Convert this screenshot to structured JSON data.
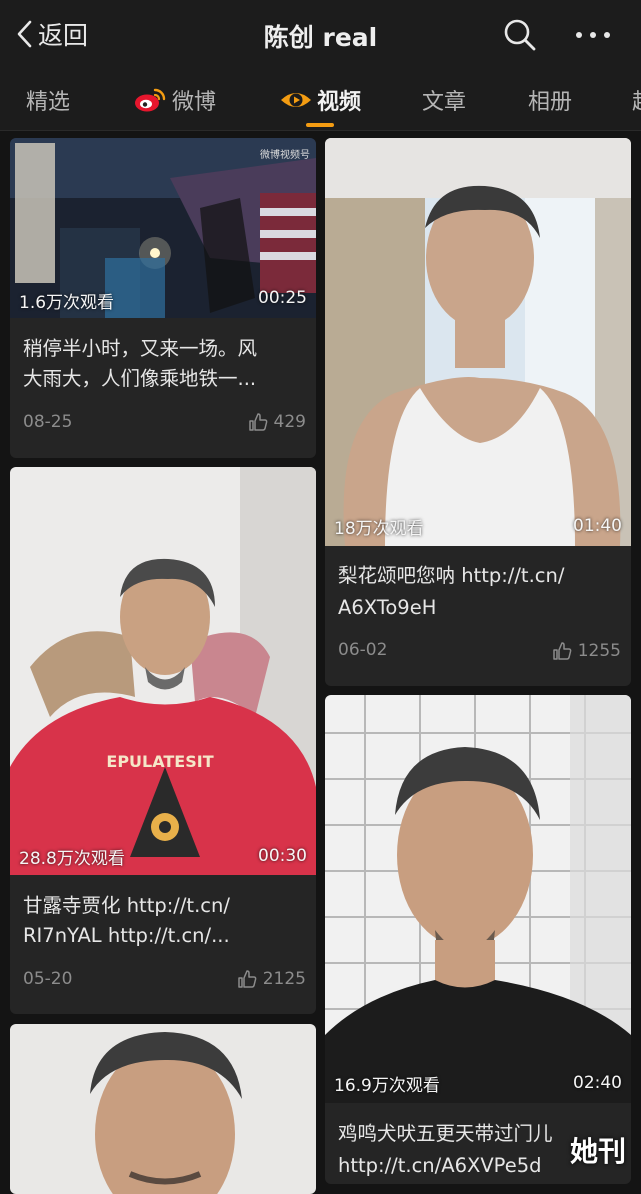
{
  "header": {
    "back_label": "返回",
    "title": "陈创 real"
  },
  "tabs": [
    {
      "label": "精选"
    },
    {
      "label": "微博"
    },
    {
      "label": "视频"
    },
    {
      "label": "文章"
    },
    {
      "label": "相册"
    },
    {
      "label": "超"
    }
  ],
  "colors": {
    "accent": "#f39c12",
    "background": "#141414",
    "card": "#252525"
  },
  "videos": [
    {
      "views": "1.6万次观看",
      "duration": "00:25",
      "caption_1": "稍停半小时，又来一场。风",
      "caption_2": "大雨大，人们像乘地铁一...",
      "date": "08-25",
      "likes": "429",
      "watermark": "微博视频号"
    },
    {
      "views": "18万次观看",
      "duration": "01:40",
      "caption_1": "梨花颂吧您呐 http://t.cn/",
      "caption_2": "A6XTo9eH",
      "date": "06-02",
      "likes": "1255"
    },
    {
      "views": "28.8万次观看",
      "duration": "00:30",
      "caption_1": "甘露寺贾化 http://t.cn/",
      "caption_2": "RI7nYAL http://t.cn/...",
      "date": "05-20",
      "likes": "2125"
    },
    {
      "views": "16.9万次观看",
      "duration": "02:40",
      "caption_1": "鸡鸣犬吠五更天带过门儿",
      "caption_2": "http://t.cn/A6XVPe5d"
    }
  ],
  "shirt_text": "EPULATESIT",
  "brand_watermark": "她刊"
}
